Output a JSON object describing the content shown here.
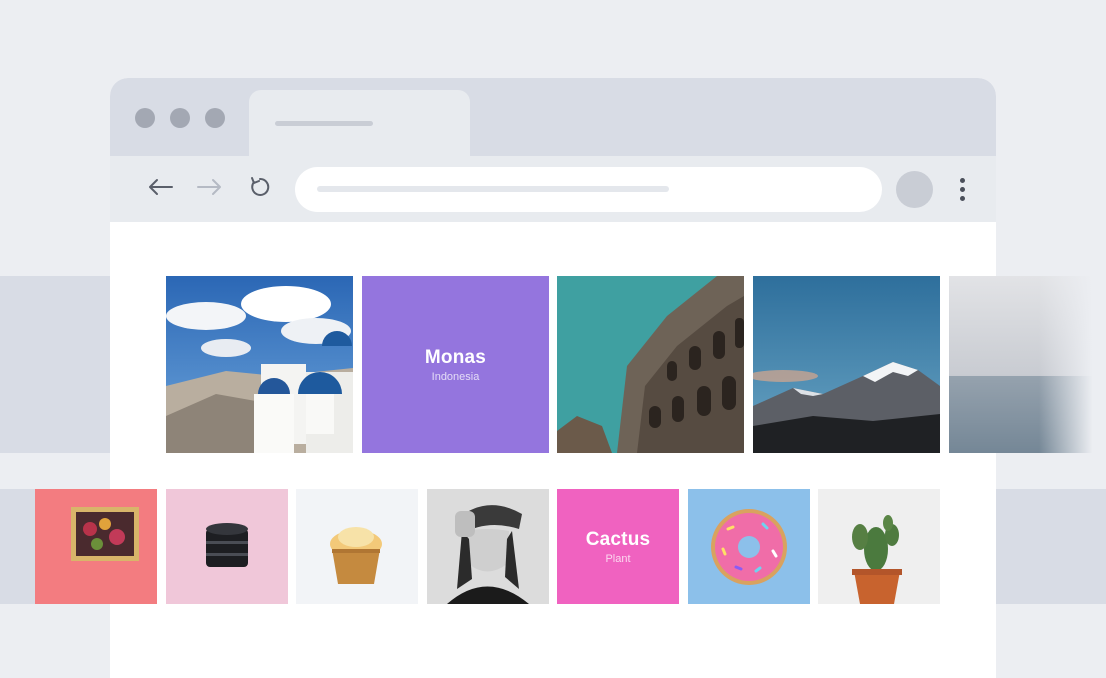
{
  "browser": {
    "window_controls": [
      "close",
      "minimize",
      "maximize"
    ],
    "tab": {
      "title": ""
    },
    "toolbar": {
      "back_icon": "arrow-left-icon",
      "forward_icon": "arrow-right-icon",
      "reload_icon": "reload-icon",
      "address_value": "",
      "menu_icon": "kebab-menu-icon"
    }
  },
  "gallery": {
    "row1": [
      {
        "kind": "photo",
        "subject": "santorini-white-houses-blue-domes"
      },
      {
        "kind": "label",
        "title": "Monas",
        "subtitle": "Indonesia",
        "color": "#9475DE"
      },
      {
        "kind": "photo",
        "subject": "colosseum"
      },
      {
        "kind": "photo",
        "subject": "snowy-mountain"
      },
      {
        "kind": "photo",
        "subject": "misty-sea"
      }
    ],
    "row2": [
      {
        "kind": "photo",
        "subject": "framed-flower-painting-on-pink-wall"
      },
      {
        "kind": "photo",
        "subject": "camera-lens-on-pink"
      },
      {
        "kind": "photo",
        "subject": "cupcake"
      },
      {
        "kind": "photo",
        "subject": "woman-portrait-black-white"
      },
      {
        "kind": "label",
        "title": "Cactus",
        "subtitle": "Plant",
        "color": "#F062C0"
      },
      {
        "kind": "photo",
        "subject": "pink-donut-on-blue"
      },
      {
        "kind": "photo",
        "subject": "potted-cactus"
      }
    ]
  },
  "colors": {
    "page_bg": "#ECEEF2",
    "band": "#D8DCE5",
    "chrome": "#E8EBEF",
    "accent_purple": "#9475DE",
    "accent_pink": "#F062C0"
  }
}
